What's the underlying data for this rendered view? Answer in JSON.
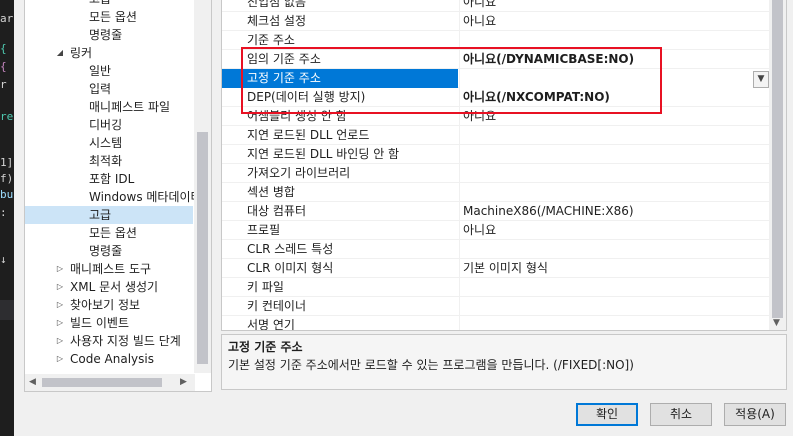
{
  "editor_strip": {
    "fragments": [
      {
        "text": "ar",
        "color": "#d4d4d4"
      },
      {
        "text": "{",
        "color": "#4ec9b0"
      },
      {
        "text": "{",
        "color": "#c586c0"
      },
      {
        "text": "r",
        "color": "#d4d4d4"
      },
      {
        "text": "re",
        "color": "#4ec9b0"
      },
      {
        "text": "1]",
        "color": "#d4d4d4"
      },
      {
        "text": "f)",
        "color": "#d4d4d4"
      },
      {
        "text": "bu",
        "color": "#9cdcfe"
      },
      {
        "text": ":",
        "color": "#d4d4d4"
      },
      {
        "text": "↓",
        "color": "#d4d4d4"
      }
    ]
  },
  "tree": {
    "items": [
      {
        "label": "고급",
        "depth": 2,
        "expander": ""
      },
      {
        "label": "모든 옵션",
        "depth": 2,
        "expander": ""
      },
      {
        "label": "명령줄",
        "depth": 2,
        "expander": ""
      },
      {
        "label": "링커",
        "depth": 1,
        "expander": "◢"
      },
      {
        "label": "일반",
        "depth": 2,
        "expander": ""
      },
      {
        "label": "입력",
        "depth": 2,
        "expander": ""
      },
      {
        "label": "매니페스트 파일",
        "depth": 2,
        "expander": ""
      },
      {
        "label": "디버깅",
        "depth": 2,
        "expander": ""
      },
      {
        "label": "시스템",
        "depth": 2,
        "expander": ""
      },
      {
        "label": "최적화",
        "depth": 2,
        "expander": ""
      },
      {
        "label": "포함 IDL",
        "depth": 2,
        "expander": ""
      },
      {
        "label": "Windows 메타데이터",
        "depth": 2,
        "expander": ""
      },
      {
        "label": "고급",
        "depth": 2,
        "expander": "",
        "selected": true
      },
      {
        "label": "모든 옵션",
        "depth": 2,
        "expander": ""
      },
      {
        "label": "명령줄",
        "depth": 2,
        "expander": ""
      },
      {
        "label": "매니페스트 도구",
        "depth": 1,
        "expander": "▷"
      },
      {
        "label": "XML 문서 생성기",
        "depth": 1,
        "expander": "▷"
      },
      {
        "label": "찾아보기 정보",
        "depth": 1,
        "expander": "▷"
      },
      {
        "label": "빌드 이벤트",
        "depth": 1,
        "expander": "▷"
      },
      {
        "label": "사용자 지정 빌드 단계",
        "depth": 1,
        "expander": "▷"
      },
      {
        "label": "Code Analysis",
        "depth": 1,
        "expander": "▷"
      }
    ]
  },
  "grid": {
    "rows": [
      {
        "name": "진입점 없음",
        "value": "아니요"
      },
      {
        "name": "체크섬 설정",
        "value": "아니요"
      },
      {
        "name": "기준 주소",
        "value": ""
      },
      {
        "name": "임의 기준 주소",
        "value": "아니요(/DYNAMICBASE:NO)",
        "bold": true
      },
      {
        "name": "고정 기준 주소",
        "value": "",
        "selected": true
      },
      {
        "name": "DEP(데이터 실행 방지)",
        "value": "아니요(/NXCOMPAT:NO)",
        "bold": true
      },
      {
        "name": "어셈블리 생성 안 함",
        "value": "아니요"
      },
      {
        "name": "지연 로드된 DLL 언로드",
        "value": ""
      },
      {
        "name": "지연 로드된 DLL 바인딩 안 함",
        "value": ""
      },
      {
        "name": "가져오기 라이브러리",
        "value": ""
      },
      {
        "name": "섹션 병합",
        "value": ""
      },
      {
        "name": "대상 컴퓨터",
        "value": "MachineX86(/MACHINE:X86)"
      },
      {
        "name": "프로필",
        "value": "아니요"
      },
      {
        "name": "CLR 스레드 특성",
        "value": ""
      },
      {
        "name": "CLR 이미지 형식",
        "value": "기본 이미지 형식"
      },
      {
        "name": "키 파일",
        "value": ""
      },
      {
        "name": "키 컨테이너",
        "value": ""
      },
      {
        "name": "서명 연기",
        "value": ""
      }
    ]
  },
  "description": {
    "title": "고정 기준 주소",
    "text": "기본 설정 기준 주소에서만 로드할 수 있는 프로그램을 만듭니다. (/FIXED[:NO])"
  },
  "buttons": {
    "ok": "확인",
    "cancel": "취소",
    "apply": "적용(A)"
  },
  "colors": {
    "selection": "#0078d7",
    "highlight": "#e81123",
    "tree_selection": "#cce4f7"
  }
}
